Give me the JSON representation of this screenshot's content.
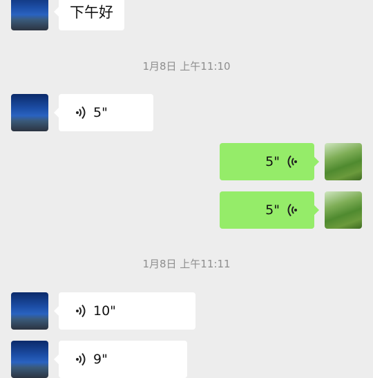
{
  "messages": [
    {
      "type": "text",
      "direction": "in",
      "text": "下午好"
    },
    {
      "type": "time",
      "text": "1月8日 上午11:10"
    },
    {
      "type": "voice",
      "direction": "in",
      "duration": "5\""
    },
    {
      "type": "voice",
      "direction": "out",
      "duration": "5\""
    },
    {
      "type": "voice",
      "direction": "out",
      "duration": "5\""
    },
    {
      "type": "time",
      "text": "1月8日 上午11:11"
    },
    {
      "type": "voice",
      "direction": "in",
      "duration": "10\""
    },
    {
      "type": "voice",
      "direction": "in",
      "duration": "9\""
    }
  ],
  "colors": {
    "background": "#ededed",
    "incoming_bubble": "#ffffff",
    "outgoing_bubble": "#95ec69",
    "timestamp_text": "#8e8e8e"
  },
  "icons": {
    "voice_in": "voice-wave-right-icon",
    "voice_out": "voice-wave-left-icon"
  }
}
